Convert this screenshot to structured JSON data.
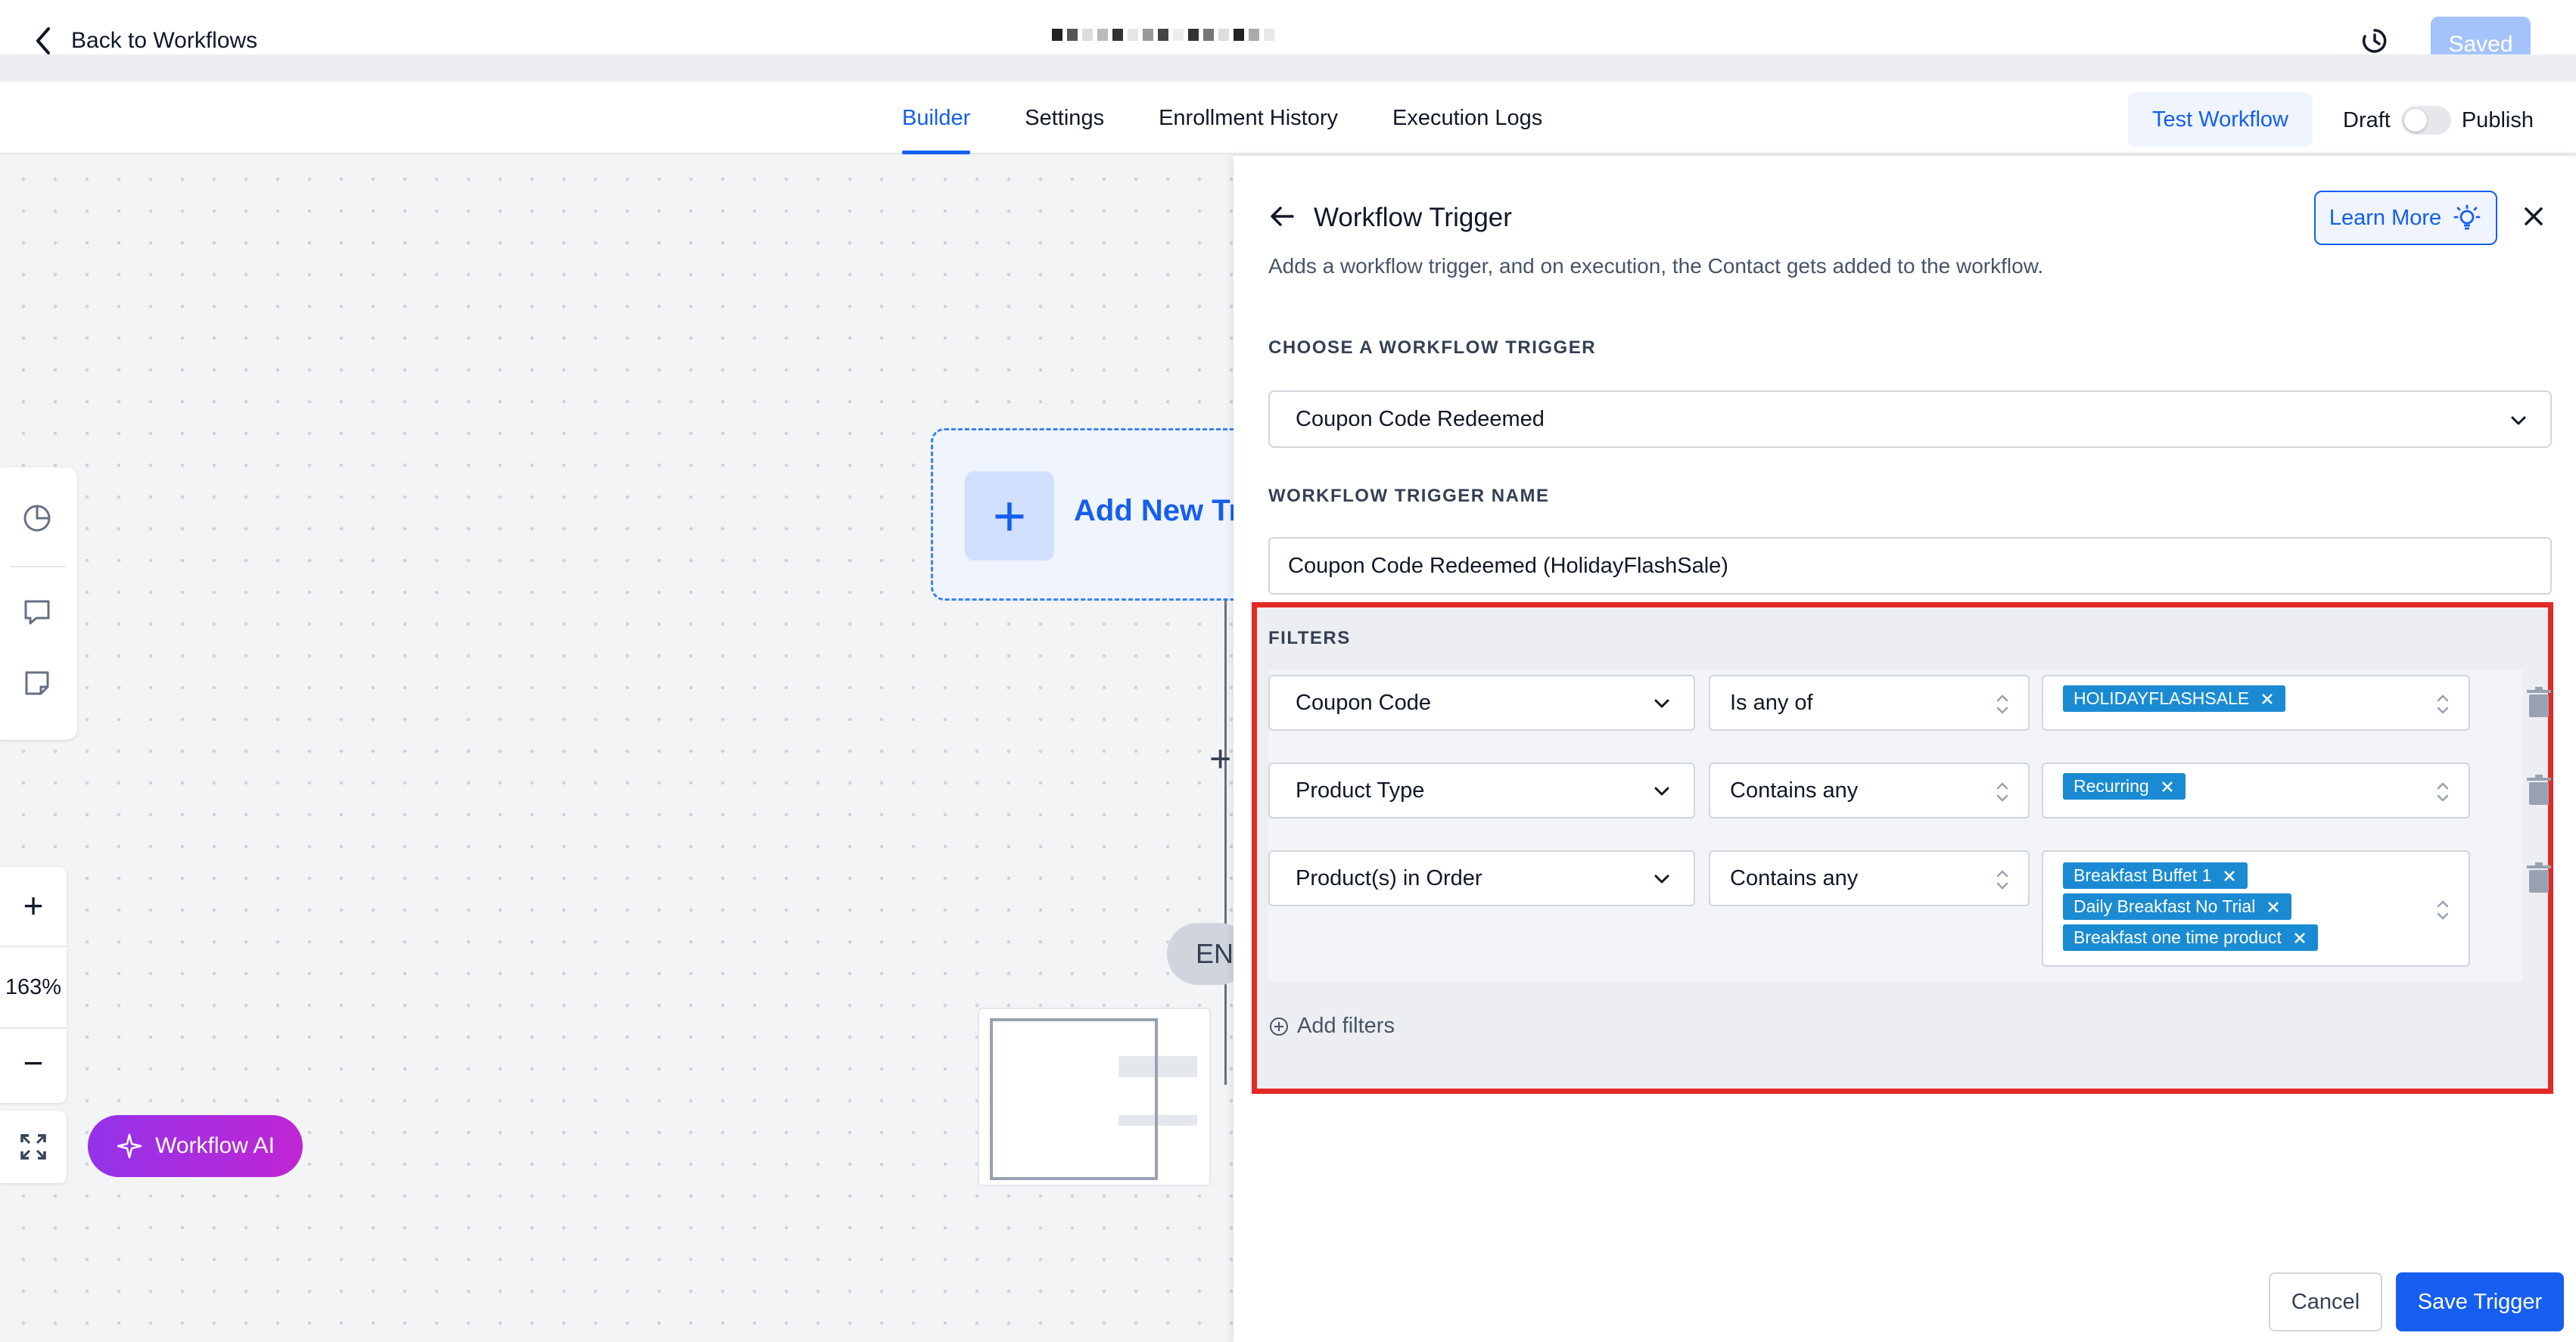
{
  "topbar": {
    "back_label": "Back to Workflows",
    "saved_label": "Saved",
    "colors": {
      "accent": "#155eef",
      "saved_bg": "#a5c3fb"
    }
  },
  "tabs": [
    {
      "label": "Builder",
      "active": true
    },
    {
      "label": "Settings",
      "active": false
    },
    {
      "label": "Enrollment History",
      "active": false
    },
    {
      "label": "Execution Logs",
      "active": false
    }
  ],
  "actions": {
    "test_workflow": "Test Workflow",
    "draft_label": "Draft",
    "publish_label": "Publish",
    "publish_toggle_on": false
  },
  "canvas": {
    "add_trigger_label": "Add New Tr",
    "end_label": "EN",
    "zoom_level": "163%",
    "workflow_ai_label": "Workflow AI"
  },
  "panel": {
    "title": "Workflow Trigger",
    "learn_more": "Learn More",
    "description": "Adds a workflow trigger, and on execution, the Contact gets added to the workflow.",
    "choose_label": "CHOOSE A WORKFLOW TRIGGER",
    "trigger_value": "Coupon Code Redeemed",
    "name_label": "WORKFLOW TRIGGER NAME",
    "name_value": "Coupon Code Redeemed (HolidayFlashSale)",
    "filters_label": "FILTERS",
    "filters": [
      {
        "field": "Coupon Code",
        "operator": "Is any of",
        "values": [
          "HOLIDAYFLASHSALE"
        ]
      },
      {
        "field": "Product Type",
        "operator": "Contains any",
        "values": [
          "Recurring"
        ]
      },
      {
        "field": "Product(s) in Order",
        "operator": "Contains any",
        "values": [
          "Breakfast Buffet 1",
          "Daily Breakfast No Trial",
          "Breakfast one time product"
        ]
      }
    ],
    "add_filters": "Add filters",
    "cancel_label": "Cancel",
    "save_label": "Save Trigger",
    "highlight_color": "#e32a24"
  }
}
